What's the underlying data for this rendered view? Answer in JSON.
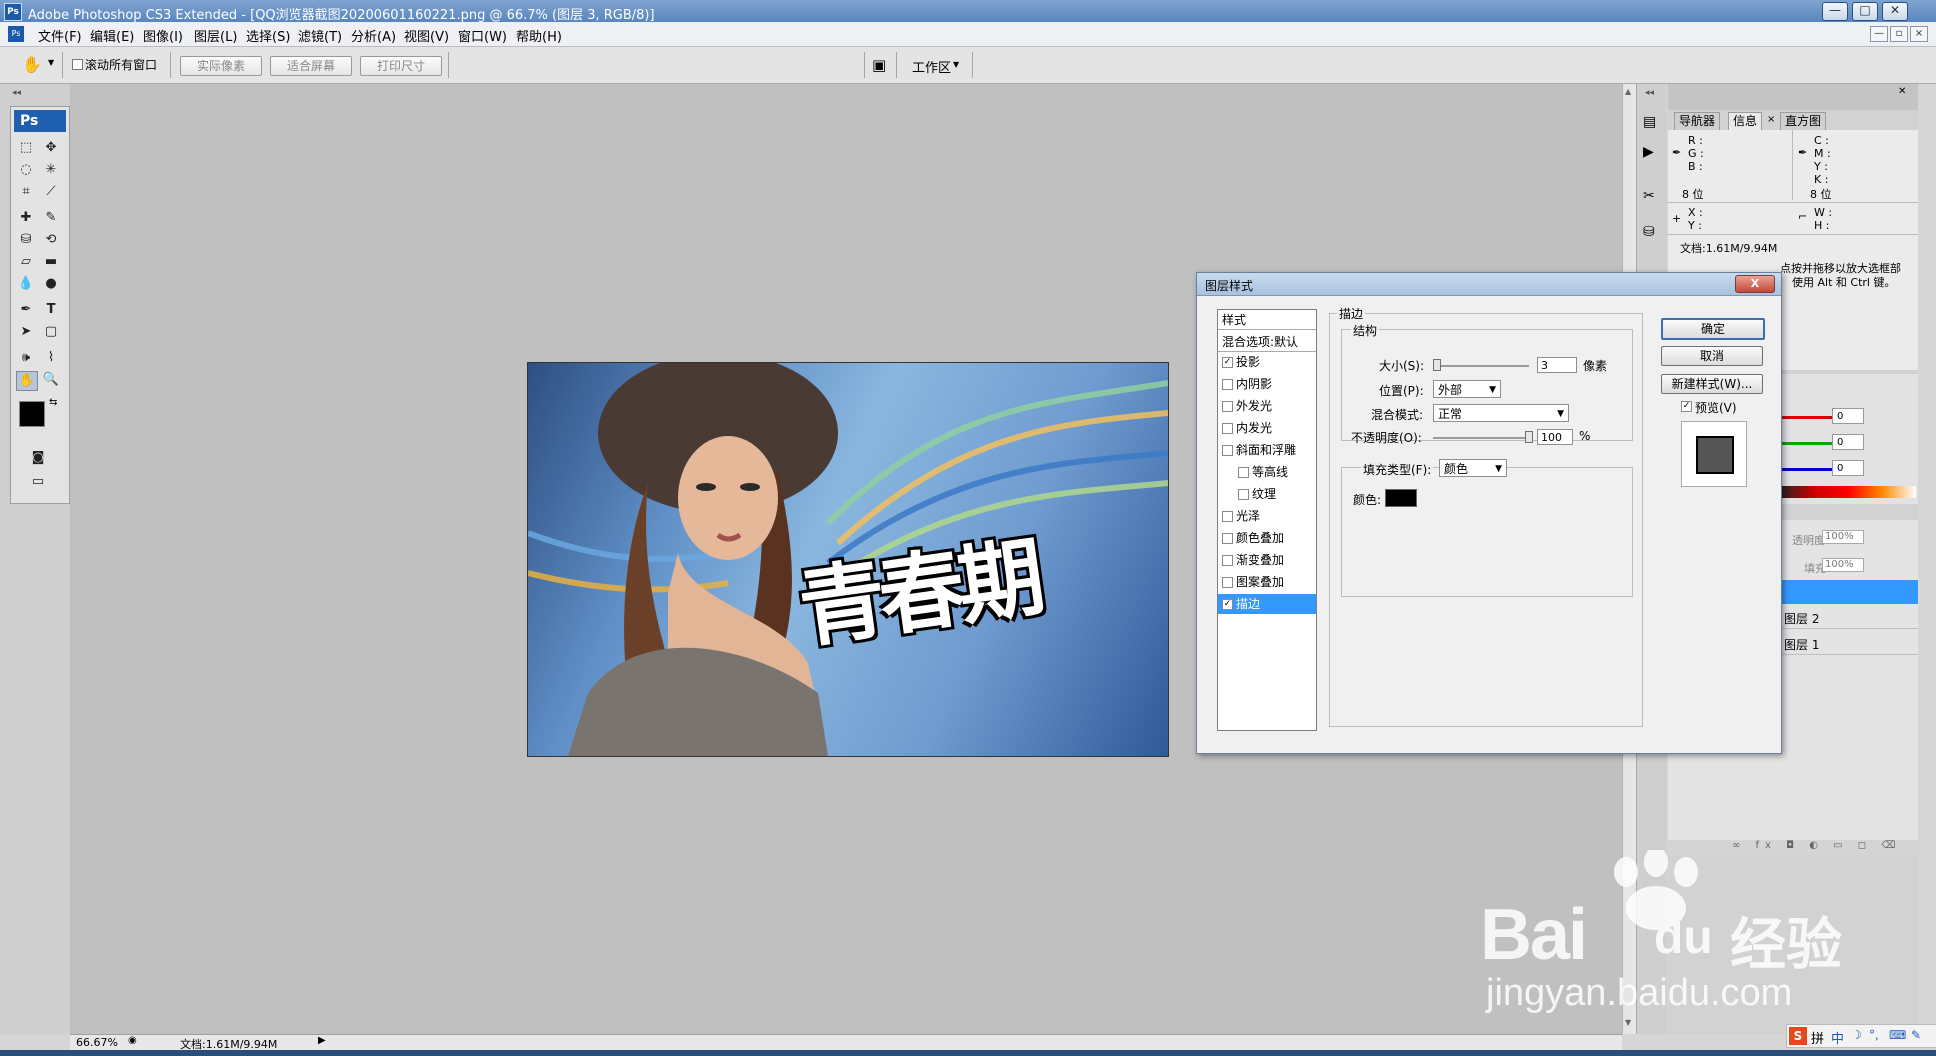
{
  "window": {
    "title": "Adobe Photoshop CS3 Extended - [QQ浏览器截图20200601160221.png @ 66.7% (图层 3, RGB/8)]",
    "controls": [
      "—",
      "□",
      "✕"
    ]
  },
  "menu": [
    "文件(F)",
    "编辑(E)",
    "图像(I)",
    "图层(L)",
    "选择(S)",
    "滤镜(T)",
    "分析(A)",
    "视图(V)",
    "窗口(W)",
    "帮助(H)"
  ],
  "options": {
    "scroll_all": "滚动所有窗口",
    "buttons": [
      "实际像素",
      "适合屏幕",
      "打印尺寸"
    ],
    "workspace": "工作区"
  },
  "toolbox": {
    "logo": "Ps"
  },
  "canvas": {
    "artwork_text": "青春期"
  },
  "status": {
    "zoom": "66.67%",
    "doc": "文档:1.61M/9.94M"
  },
  "panels": {
    "tabs": [
      "导航器",
      "信息",
      "直方图"
    ],
    "info": {
      "rgb": [
        "R :",
        "G :",
        "B :"
      ],
      "cmyk": [
        "C :",
        "M :",
        "Y :",
        "K :"
      ],
      "bits_left": "8 位",
      "bits_right": "8 位",
      "xy": [
        "X :",
        "Y :"
      ],
      "wh": [
        "W :",
        "H :"
      ],
      "doc": "文档:1.61M/9.94M",
      "hint1": "点按并拖移以放大选框部",
      "hint2": "使用 Alt 和 Ctrl 键。"
    },
    "color": {
      "values": [
        "0",
        "0",
        "0"
      ]
    },
    "layers": {
      "opacity_label": "透明度:",
      "opacity": "100%",
      "fill_label": "填充:",
      "fill": "100%",
      "items": [
        "图层 2",
        "图层 1"
      ]
    }
  },
  "dialog": {
    "title": "图层样式",
    "styles_header": "样式",
    "blend_default": "混合选项:默认",
    "styles": [
      {
        "label": "投影",
        "checked": true
      },
      {
        "label": "内阴影",
        "checked": false
      },
      {
        "label": "外发光",
        "checked": false
      },
      {
        "label": "内发光",
        "checked": false
      },
      {
        "label": "斜面和浮雕",
        "checked": false
      },
      {
        "label": "等高线",
        "checked": false
      },
      {
        "label": "纹理",
        "checked": false
      },
      {
        "label": "光泽",
        "checked": false
      },
      {
        "label": "颜色叠加",
        "checked": false
      },
      {
        "label": "渐变叠加",
        "checked": false
      },
      {
        "label": "图案叠加",
        "checked": false
      },
      {
        "label": "描边",
        "checked": true
      }
    ],
    "section_title": "描边",
    "structure": "结构",
    "size_label": "大小(S):",
    "size_value": "3",
    "size_unit": "像素",
    "position_label": "位置(P):",
    "position_value": "外部",
    "blend_label": "混合模式:",
    "blend_value": "正常",
    "opacity_label": "不透明度(O):",
    "opacity_value": "100",
    "opacity_unit": "%",
    "fill_type_label": "填充类型(F):",
    "fill_type_value": "颜色",
    "color_label": "颜色:",
    "stroke_color": "#000000",
    "ok": "确定",
    "cancel": "取消",
    "new_style": "新建样式(W)...",
    "preview": "预览(V)"
  },
  "watermark": {
    "brand": "Bai",
    "brand2": "du",
    "cn": "经验",
    "url": "jingyan.baidu.com"
  },
  "tray": {
    "ime": [
      "拼",
      "中"
    ]
  }
}
